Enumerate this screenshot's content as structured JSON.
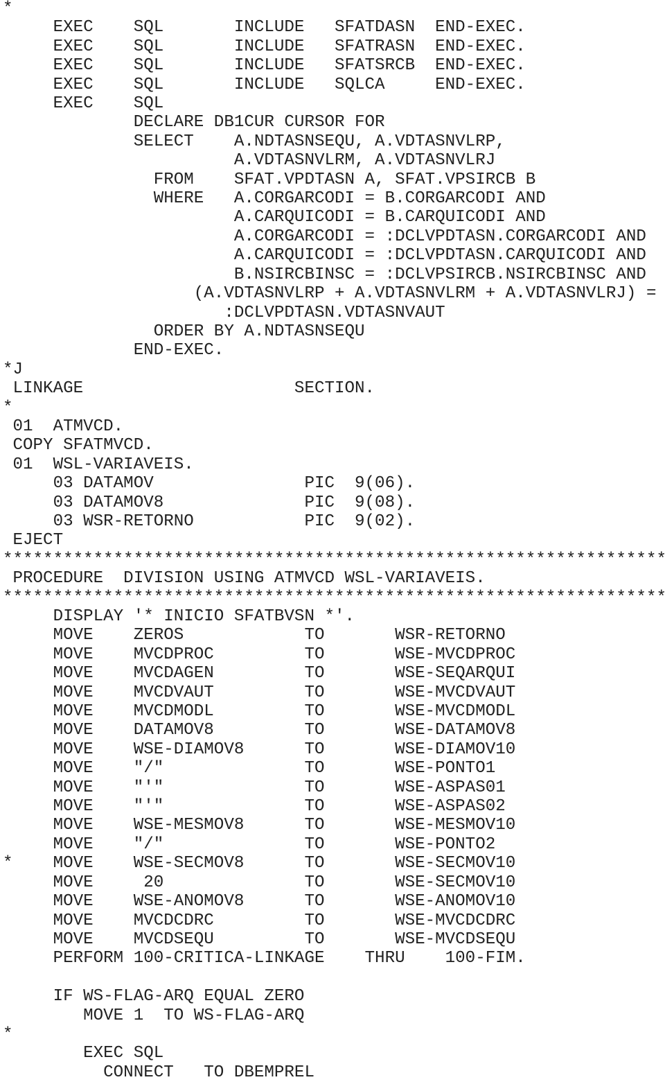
{
  "document": {
    "type": "COBOL source listing",
    "lines": [
      "*",
      "     EXEC    SQL       INCLUDE   SFATDASN  END-EXEC.",
      "     EXEC    SQL       INCLUDE   SFATRASN  END-EXEC.",
      "     EXEC    SQL       INCLUDE   SFATSRCB  END-EXEC.",
      "     EXEC    SQL       INCLUDE   SQLCA     END-EXEC.",
      "     EXEC    SQL",
      "             DECLARE DB1CUR CURSOR FOR",
      "             SELECT    A.NDTASNSEQU, A.VDTASNVLRP,",
      "                       A.VDTASNVLRM, A.VDTASNVLRJ",
      "               FROM    SFAT.VPDTASN A, SFAT.VPSIRCB B",
      "               WHERE   A.CORGARCODI = B.CORGARCODI AND",
      "                       A.CARQUICODI = B.CARQUICODI AND",
      "                       A.CORGARCODI = :DCLVPDTASN.CORGARCODI AND",
      "                       A.CARQUICODI = :DCLVPDTASN.CARQUICODI AND",
      "                       B.NSIRCBINSC = :DCLVPSIRCB.NSIRCBINSC AND",
      "                   (A.VDTASNVLRP + A.VDTASNVLRM + A.VDTASNVLRJ) =",
      "                      :DCLVPDTASN.VDTASNVAUT",
      "               ORDER BY A.NDTASNSEQU",
      "             END-EXEC.",
      "*J",
      " LINKAGE                     SECTION.",
      "*",
      " 01  ATMVCD.",
      " COPY SFATMVCD.",
      " 01  WSL-VARIAVEIS.",
      "     03 DATAMOV               PIC  9(06).",
      "     03 DATAMOV8              PIC  9(08).",
      "     03 WSR-RETORNO           PIC  9(02).",
      " EJECT",
      "******************************************************************",
      " PROCEDURE  DIVISION USING ATMVCD WSL-VARIAVEIS.",
      "******************************************************************",
      "     DISPLAY '* INICIO SFATBVSN *'.",
      "     MOVE    ZEROS            TO       WSR-RETORNO",
      "     MOVE    MVCDPROC         TO       WSE-MVCDPROC",
      "     MOVE    MVCDAGEN         TO       WSE-SEQARQUI",
      "     MOVE    MVCDVAUT         TO       WSE-MVCDVAUT",
      "     MOVE    MVCDMODL         TO       WSE-MVCDMODL",
      "     MOVE    DATAMOV8         TO       WSE-DATAMOV8",
      "     MOVE    WSE-DIAMOV8      TO       WSE-DIAMOV10",
      "     MOVE    \"/\"              TO       WSE-PONTO1",
      "     MOVE    \"'\"              TO       WSE-ASPAS01",
      "     MOVE    \"'\"              TO       WSE-ASPAS02",
      "     MOVE    WSE-MESMOV8      TO       WSE-MESMOV10",
      "     MOVE    \"/\"              TO       WSE-PONTO2",
      "*    MOVE    WSE-SECMOV8      TO       WSE-SECMOV10",
      "     MOVE     20              TO       WSE-SECMOV10",
      "     MOVE    WSE-ANOMOV8      TO       WSE-ANOMOV10",
      "     MOVE    MVCDCDRC         TO       WSE-MVCDCDRC",
      "     MOVE    MVCDSEQU         TO       WSE-MVCDSEQU",
      "     PERFORM 100-CRITICA-LINKAGE    THRU    100-FIM.",
      "",
      "     IF WS-FLAG-ARQ EQUAL ZERO",
      "        MOVE 1  TO WS-FLAG-ARQ",
      "*",
      "        EXEC SQL",
      "          CONNECT   TO DBEMPREL"
    ]
  }
}
